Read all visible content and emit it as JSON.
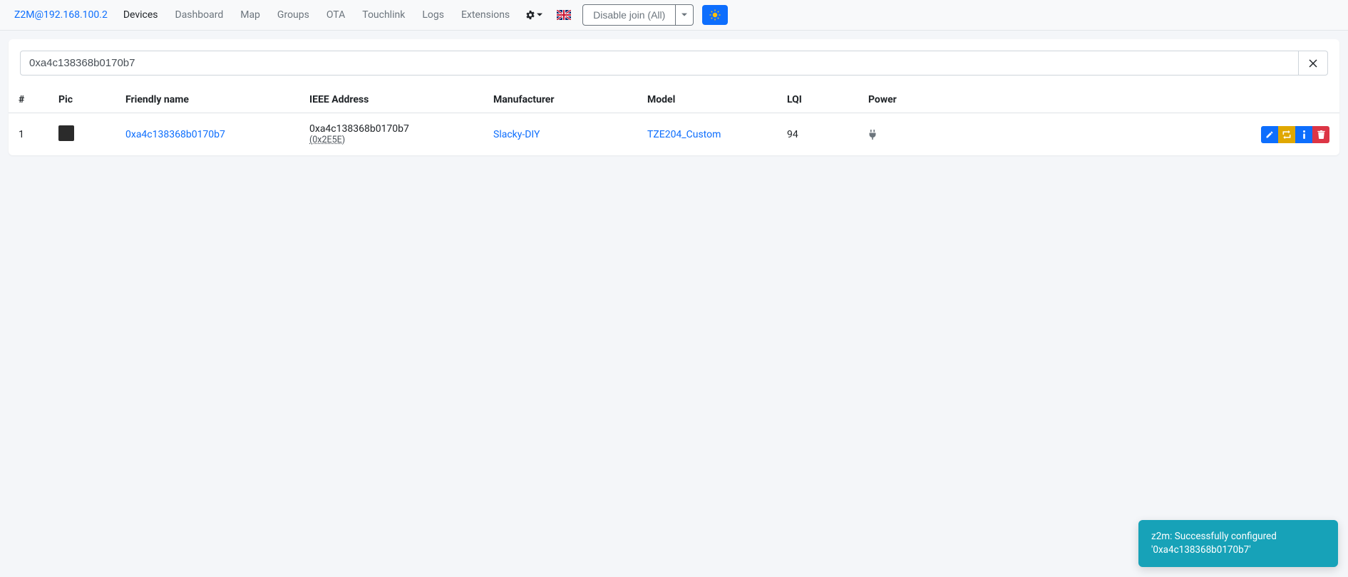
{
  "nav": {
    "brand": "Z2M@192.168.100.2",
    "items": [
      "Devices",
      "Dashboard",
      "Map",
      "Groups",
      "OTA",
      "Touchlink",
      "Logs",
      "Extensions"
    ],
    "active_index": 0,
    "disable_join_label": "Disable join (All)"
  },
  "search": {
    "value": "0xa4c138368b0170b7"
  },
  "table": {
    "headers": {
      "num": "#",
      "pic": "Pic",
      "friendly": "Friendly name",
      "ieee": "IEEE Address",
      "manufacturer": "Manufacturer",
      "model": "Model",
      "lqi": "LQI",
      "power": "Power"
    },
    "rows": [
      {
        "num": "1",
        "friendly_name": "0xa4c138368b0170b7",
        "ieee_address": "0xa4c138368b0170b7",
        "ieee_short": "(0x2E5E)",
        "manufacturer": "Slacky-DIY",
        "model": "TZE204_Custom",
        "lqi": "94"
      }
    ]
  },
  "toast": {
    "message": "z2m: Successfully configured '0xa4c138368b0170b7'"
  }
}
